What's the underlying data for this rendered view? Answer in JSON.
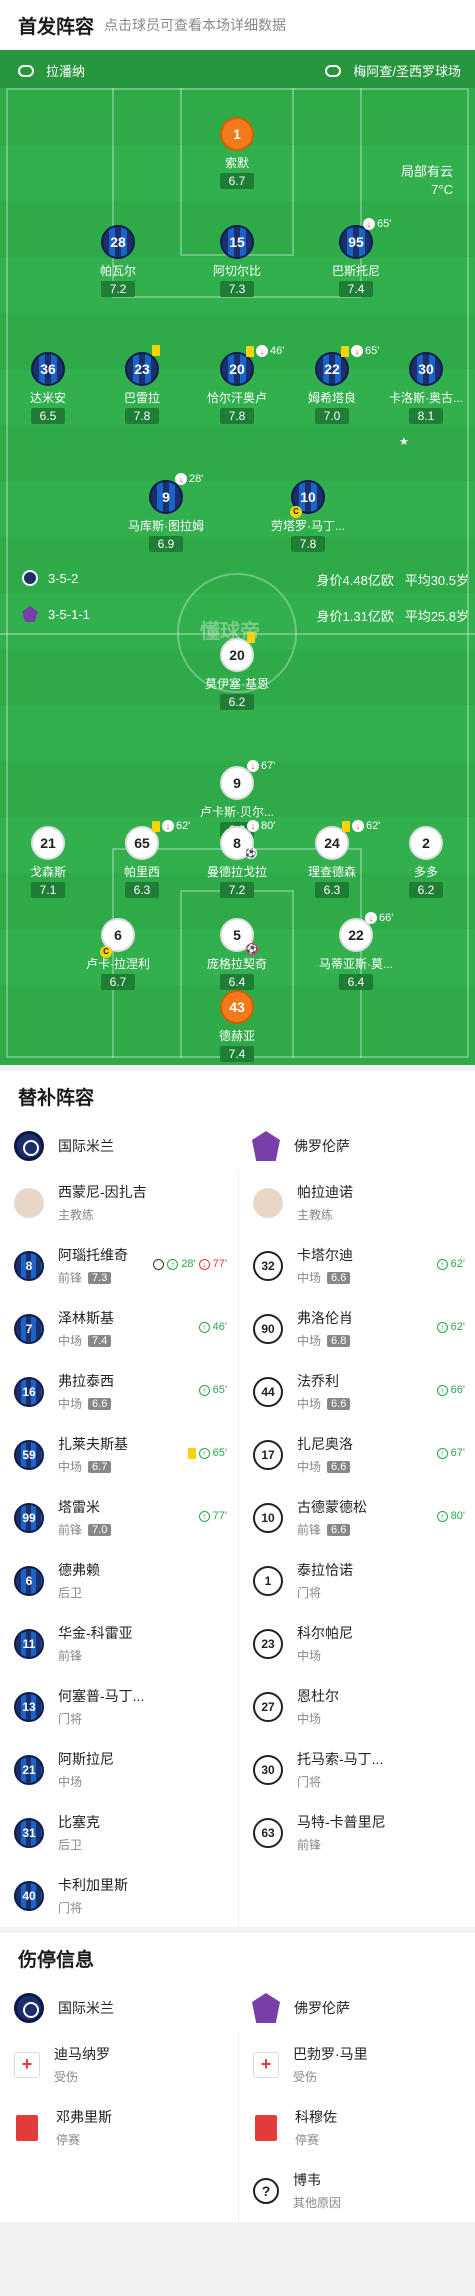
{
  "lineup": {
    "title": "首发阵容",
    "subtitle": "点击球员可查看本场详细数据"
  },
  "pitch": {
    "coach_left": "拉潘纳",
    "venue": "梅阿查/圣西罗球场",
    "weather1": "局部有云",
    "weather2": "7°C",
    "watermark": "懂球帝",
    "home_formation": "3-5-2",
    "home_value": "身价4.48亿欧",
    "home_age": "平均30.5岁",
    "away_formation": "3-5-1-1",
    "away_value": "身价1.31亿欧",
    "away_age": "平均25.8岁",
    "home": [
      {
        "num": "1",
        "name": "索默",
        "rating": "6.7"
      },
      {
        "num": "28",
        "name": "帕瓦尔",
        "rating": "7.2"
      },
      {
        "num": "15",
        "name": "阿切尔比",
        "rating": "7.3"
      },
      {
        "num": "95",
        "name": "巴斯托尼",
        "rating": "7.4",
        "ev": "65'"
      },
      {
        "num": "36",
        "name": "达米安",
        "rating": "6.5"
      },
      {
        "num": "23",
        "name": "巴雷拉",
        "rating": "7.8"
      },
      {
        "num": "20",
        "name": "恰尔汗奥卢",
        "rating": "7.8",
        "ev": "46'"
      },
      {
        "num": "22",
        "name": "姆希塔良",
        "rating": "7.0",
        "ev": "65'"
      },
      {
        "num": "30",
        "name": "卡洛斯·奥古...",
        "rating": "8.1"
      },
      {
        "num": "9",
        "name": "马库斯·图拉姆",
        "rating": "6.9",
        "ev": "28'"
      },
      {
        "num": "10",
        "name": "劳塔罗·马丁...",
        "rating": "7.8"
      }
    ],
    "away": [
      {
        "num": "20",
        "name": "莫伊塞·基恩",
        "rating": "6.2"
      },
      {
        "num": "9",
        "name": "卢卡斯·贝尔...",
        "rating": "6.3",
        "ev": "67'"
      },
      {
        "num": "21",
        "name": "戈森斯",
        "rating": "7.1"
      },
      {
        "num": "65",
        "name": "帕里西",
        "rating": "6.3",
        "ev": "62'"
      },
      {
        "num": "8",
        "name": "曼德拉戈拉",
        "rating": "7.2",
        "ev": "80'"
      },
      {
        "num": "24",
        "name": "理查德森",
        "rating": "6.3",
        "ev": "62'"
      },
      {
        "num": "2",
        "name": "多多",
        "rating": "6.2"
      },
      {
        "num": "6",
        "name": "卢卡·拉涅利",
        "rating": "6.7"
      },
      {
        "num": "5",
        "name": "庞格拉契奇",
        "rating": "6.4"
      },
      {
        "num": "22",
        "name": "马蒂亚斯·莫...",
        "rating": "6.4",
        "ev": "66'"
      },
      {
        "num": "43",
        "name": "德赫亚",
        "rating": "7.4"
      }
    ]
  },
  "subs": {
    "title": "替补阵容",
    "home_team": "国际米兰",
    "away_team": "佛罗伦萨",
    "home_coach": {
      "name": "西蒙尼-因扎吉",
      "role": "主教练"
    },
    "away_coach": {
      "name": "帕拉迪诺",
      "role": "主教练"
    },
    "home": [
      {
        "num": "8",
        "name": "阿瑙托维奇",
        "pos": "前锋",
        "rating": "7.3",
        "ev_in": "28'",
        "ev_out": "77'"
      },
      {
        "num": "7",
        "name": "泽林斯基",
        "pos": "中场",
        "rating": "7.4",
        "ev_in": "46'"
      },
      {
        "num": "16",
        "name": "弗拉泰西",
        "pos": "中场",
        "rating": "6.6",
        "ev_in": "65'"
      },
      {
        "num": "59",
        "name": "扎莱夫斯基",
        "pos": "中场",
        "rating": "6.7",
        "ev_in": "65'"
      },
      {
        "num": "99",
        "name": "塔雷米",
        "pos": "前锋",
        "rating": "7.0",
        "ev_in": "77'"
      },
      {
        "num": "6",
        "name": "德弗赖",
        "pos": "后卫"
      },
      {
        "num": "11",
        "name": "华金-科雷亚",
        "pos": "前锋"
      },
      {
        "num": "13",
        "name": "何塞普-马丁...",
        "pos": "门将"
      },
      {
        "num": "21",
        "name": "阿斯拉尼",
        "pos": "中场"
      },
      {
        "num": "31",
        "name": "比塞克",
        "pos": "后卫"
      },
      {
        "num": "40",
        "name": "卡利加里斯",
        "pos": "门将"
      }
    ],
    "away": [
      {
        "num": "32",
        "name": "卡塔尔迪",
        "pos": "中场",
        "rating": "6.6",
        "ev_in": "62'"
      },
      {
        "num": "90",
        "name": "弗洛伦肖",
        "pos": "中场",
        "rating": "6.8",
        "ev_in": "62'"
      },
      {
        "num": "44",
        "name": "法乔利",
        "pos": "中场",
        "rating": "6.6",
        "ev_in": "66'"
      },
      {
        "num": "17",
        "name": "扎尼奥洛",
        "pos": "中场",
        "rating": "6.6",
        "ev_in": "67'"
      },
      {
        "num": "10",
        "name": "古德蒙德松",
        "pos": "前锋",
        "rating": "6.6",
        "ev_in": "80'"
      },
      {
        "num": "1",
        "name": "泰拉恰诺",
        "pos": "门将"
      },
      {
        "num": "23",
        "name": "科尔帕尼",
        "pos": "中场"
      },
      {
        "num": "27",
        "name": "恩杜尔",
        "pos": "中场"
      },
      {
        "num": "30",
        "name": "托马索-马丁...",
        "pos": "门将"
      },
      {
        "num": "63",
        "name": "马特-卡普里尼",
        "pos": "前锋"
      }
    ]
  },
  "injuries": {
    "title": "伤停信息",
    "home_team": "国际米兰",
    "away_team": "佛罗伦萨",
    "home": [
      {
        "name": "迪马纳罗",
        "reason": "受伤"
      },
      {
        "name": "邓弗里斯",
        "reason": "停赛"
      }
    ],
    "away": [
      {
        "name": "巴勃罗·马里",
        "reason": "受伤"
      },
      {
        "name": "科穆佐",
        "reason": "停赛"
      },
      {
        "name": "博韦",
        "reason": "其他原因"
      }
    ]
  }
}
